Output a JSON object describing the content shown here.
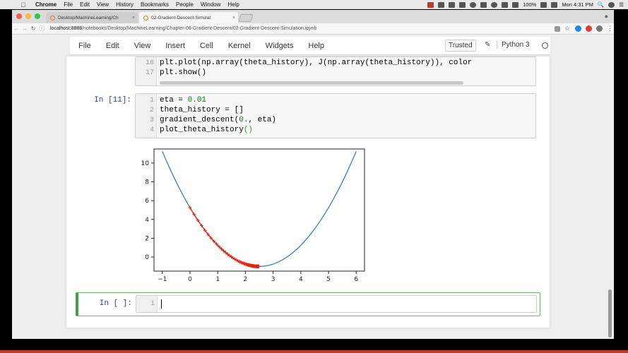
{
  "os_menubar": {
    "apple_icon": "apple-icon",
    "app": "Chrome",
    "items": [
      "File",
      "Edit",
      "View",
      "History",
      "Bookmarks",
      "People",
      "Window",
      "Help"
    ],
    "battery": "100%",
    "clock": "Mon 4:31 PM"
  },
  "browser": {
    "tabs": [
      {
        "title": "Desktop/MachineLearning/Ch"
      },
      {
        "title": "02-Gradient-Descent-Simulat"
      }
    ],
    "url_host": "localhost:8888",
    "url_path": "/notebooks/Desktop/MachineLearning/Chapter-06-Gradient-Descent/02-Gradient-Descent-Simulation.ipynb"
  },
  "notebook": {
    "menu": [
      "File",
      "Edit",
      "View",
      "Insert",
      "Cell",
      "Kernel",
      "Widgets",
      "Help"
    ],
    "trusted": "Trusted",
    "kernel_name": "Python 3",
    "prev_cell": {
      "lines": [
        {
          "n": "16",
          "code": "plt.plot(np.array(theta_history), J(np.array(theta_history)), color"
        },
        {
          "n": "17",
          "code": "plt.show()"
        }
      ]
    },
    "cell11": {
      "prompt": "In [11]:",
      "lines": [
        {
          "n": "1",
          "a": "eta = ",
          "num": "0.01",
          "b": ""
        },
        {
          "n": "2",
          "a": "theta_history = []",
          "num": "",
          "b": ""
        },
        {
          "n": "3",
          "a": "gradient_descent(",
          "num": "0.",
          "b": ", eta)"
        },
        {
          "n": "4",
          "a": "plot_theta_history",
          "num": "",
          "b": "()"
        }
      ]
    },
    "empty_cell": {
      "prompt": "In [ ]:",
      "line_number": "1"
    }
  },
  "chart_data": {
    "type": "line",
    "title": "",
    "xlabel": "",
    "ylabel": "",
    "xlim": [
      -1.3,
      6.3
    ],
    "ylim": [
      -1.5,
      11.5
    ],
    "xticks": [
      "−1",
      "0",
      "1",
      "2",
      "3",
      "4",
      "5",
      "6"
    ],
    "xtick_values": [
      -1,
      0,
      1,
      2,
      3,
      4,
      5,
      6
    ],
    "yticks": [
      "0",
      "2",
      "4",
      "6",
      "8",
      "10"
    ],
    "ytick_values": [
      0,
      2,
      4,
      6,
      8,
      10
    ],
    "series": [
      {
        "style": "line",
        "color": "#3b7dc4",
        "function": "(x-2.5)^2 - 1",
        "x_range": [
          -1,
          6
        ]
      },
      {
        "style": "line+markers",
        "marker": "+",
        "color": "#e8200c",
        "eta": 0.01,
        "start": 0.0,
        "approx_end": 2.48
      }
    ]
  }
}
